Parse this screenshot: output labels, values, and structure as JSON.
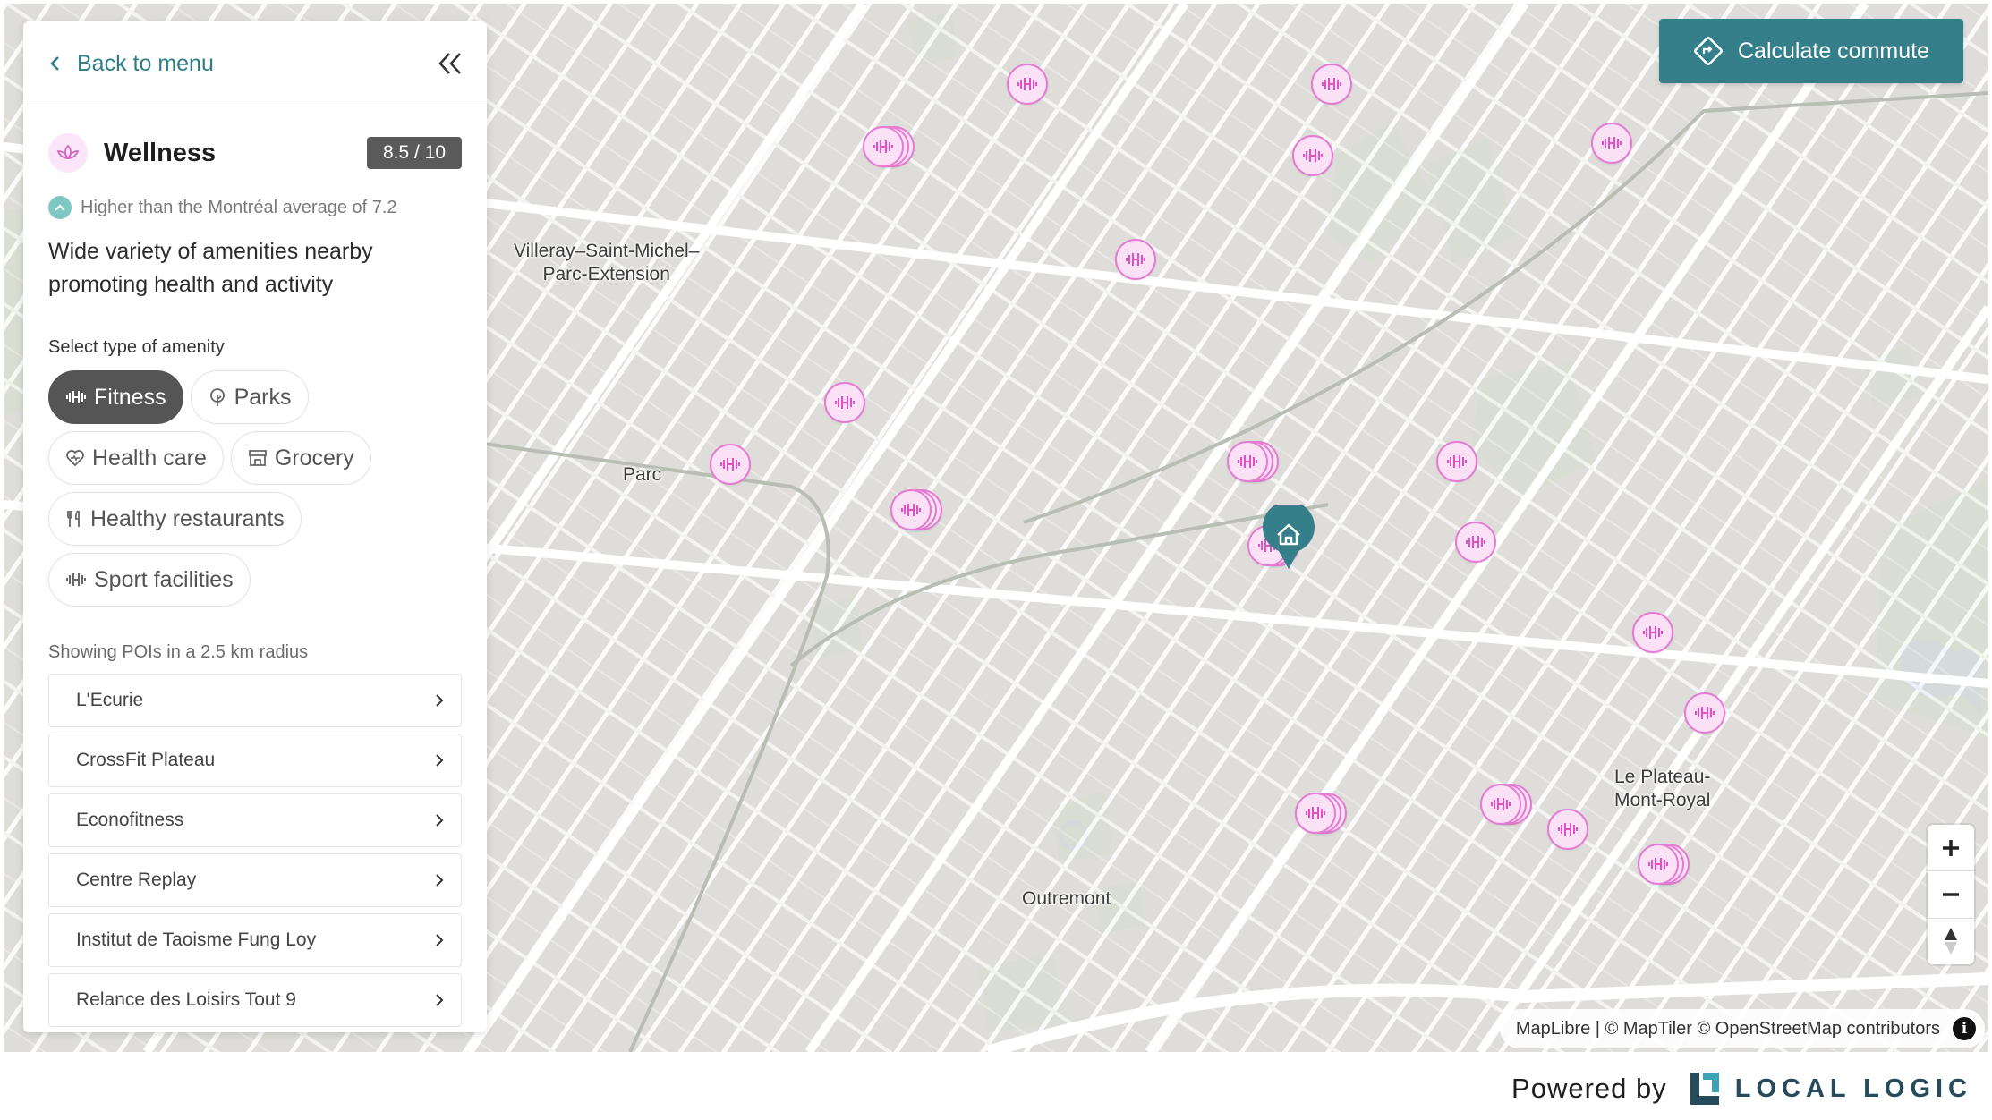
{
  "sidebar": {
    "back_label": "Back to menu",
    "category_title": "Wellness",
    "score": "8.5 / 10",
    "comparison": "Higher than the Montréal average of 7.2",
    "description": "Wide variety of amenities nearby promoting health and activity",
    "select_label": "Select type of amenity",
    "amenities": [
      {
        "label": "Fitness",
        "icon": "dumbbell-icon",
        "active": true
      },
      {
        "label": "Parks",
        "icon": "tree-icon",
        "active": false
      },
      {
        "label": "Health care",
        "icon": "heart-icon",
        "active": false
      },
      {
        "label": "Grocery",
        "icon": "store-icon",
        "active": false
      },
      {
        "label": "Healthy restaurants",
        "icon": "utensils-icon",
        "active": false
      },
      {
        "label": "Sport facilities",
        "icon": "dumbbell-icon",
        "active": false
      }
    ],
    "radius_text": "Showing POIs in a 2.5 km radius",
    "pois": [
      "L'Ecurie",
      "CrossFit Plateau",
      "Econofitness",
      "Centre Replay",
      "Institut de Taoisme Fung Loy",
      "Relance des Loisirs Tout 9"
    ]
  },
  "map": {
    "labels": {
      "villeray": "Villeray–Saint-Michel–\nParc-Extension",
      "parc": "Parc",
      "outremont": "Outremont",
      "plateau": "Le Plateau-\nMont-Royal"
    },
    "commute_label": "Calculate commute",
    "attribution": "MapLibre | © MapTiler © OpenStreetMap contributors",
    "info_glyph": "i",
    "marker_icon": "dumbbell-icon",
    "home_icon": "home-icon"
  },
  "footer": {
    "powered_by": "Powered by",
    "brand": "LOCAL LOGIC"
  },
  "colors": {
    "accent": "#347f89",
    "marker_fill": "#fbe1f6",
    "marker_stroke": "#e57cd3",
    "score_bg": "#5a5a5a"
  }
}
